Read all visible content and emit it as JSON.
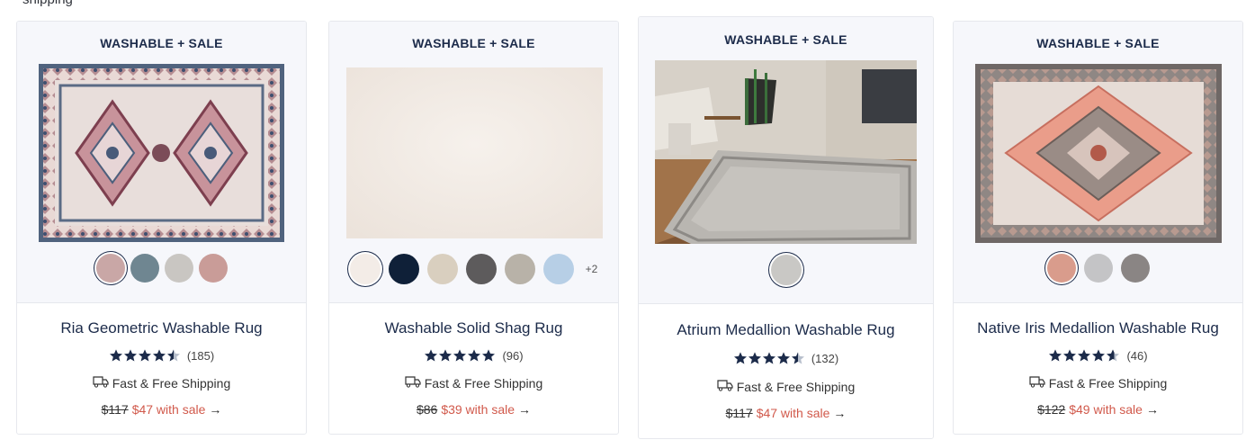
{
  "page": {
    "top_fragment": "shipping"
  },
  "products": [
    {
      "badge": "WASHABLE + SALE",
      "title": "Ria Geometric Washable Rug",
      "rating": 4.5,
      "reviews": "(185)",
      "shipping": "Fast & Free Shipping",
      "old_price": "$117",
      "sale_price": "$47 with sale",
      "arrow": "→",
      "swatches": [
        "#c9a7a6",
        "#6f8691",
        "#c9c6c2",
        "#c99c98"
      ],
      "more": ""
    },
    {
      "badge": "WASHABLE + SALE",
      "title": "Washable Solid Shag Rug",
      "rating": 5,
      "reviews": "(96)",
      "shipping": "Fast & Free Shipping",
      "old_price": "$86",
      "sale_price": "$39 with sale",
      "arrow": "→",
      "swatches": [
        "#f3ece7",
        "#0f2038",
        "#d9cfbf",
        "#5d5b5c",
        "#b8b2a8",
        "#b7cfe6"
      ],
      "more": "+2"
    },
    {
      "badge": "WASHABLE + SALE",
      "title": "Atrium Medallion Washable Rug",
      "rating": 4.5,
      "reviews": "(132)",
      "shipping": "Fast & Free Shipping",
      "old_price": "$117",
      "sale_price": "$47 with sale",
      "arrow": "→",
      "swatches": [
        "#c9c8c5"
      ],
      "more": ""
    },
    {
      "badge": "WASHABLE + SALE",
      "title": "Native Iris Medallion Washable Rug",
      "rating": 4.5,
      "reviews": "(46)",
      "shipping": "Fast & Free Shipping",
      "old_price": "$122",
      "sale_price": "$49 with sale",
      "arrow": "→",
      "swatches": [
        "#d99c8c",
        "#c4c4c6",
        "#8a8584"
      ],
      "more": ""
    }
  ],
  "colors": {
    "navy": "#1c2b4a",
    "sale": "#d1594b",
    "panel": "#f6f7fb"
  }
}
